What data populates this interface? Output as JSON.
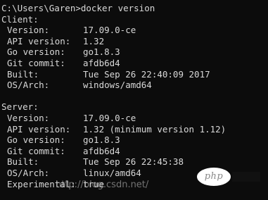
{
  "prompt": "C:\\Users\\Garen>docker version",
  "client": {
    "header": "Client:",
    "rows": [
      {
        "k": "Version:",
        "v": "17.09.0-ce"
      },
      {
        "k": "API version:",
        "v": "1.32"
      },
      {
        "k": "Go version:",
        "v": "go1.8.3"
      },
      {
        "k": "Git commit:",
        "v": "afdb6d4"
      },
      {
        "k": "Built:",
        "v": "Tue Sep 26 22:40:09 2017"
      },
      {
        "k": "OS/Arch:",
        "v": "windows/amd64"
      }
    ]
  },
  "server": {
    "header": "Server:",
    "rows": [
      {
        "k": "Version:",
        "v": "17.09.0-ce"
      },
      {
        "k": "API version:",
        "v": "1.32 (minimum version 1.12)"
      },
      {
        "k": "Go version:",
        "v": "go1.8.3"
      },
      {
        "k": "Git commit:",
        "v": "afdb6d4"
      },
      {
        "k": "Built:",
        "v": "Tue Sep 26 22:45:38"
      },
      {
        "k": "OS/Arch:",
        "v": "linux/amd64"
      },
      {
        "k": "Experimental:",
        "v": "true"
      }
    ]
  },
  "watermark": {
    "text": "http://blog.csdn.net/",
    "logo_text": "php"
  },
  "colors": {
    "background": "#0c0c0c",
    "foreground": "#d8d8d8"
  }
}
